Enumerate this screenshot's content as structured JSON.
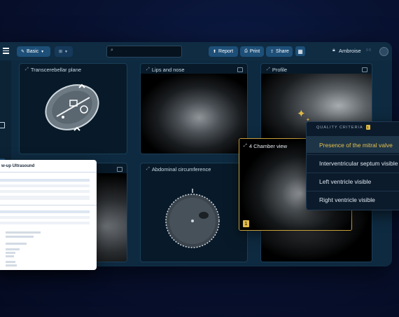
{
  "toolbar": {
    "view_label": "Basic",
    "report_label": "Report",
    "print_label": "Print",
    "share_label": "Share",
    "user_name": "Ambroise",
    "user_extra": "0  0"
  },
  "panels": {
    "transcerebellar": "Transcerebellar plane",
    "lips_nose": "Lips and nose",
    "profile": "Profile",
    "abdominal": "Abdominal circumference",
    "four_chamber": "4 Chamber view",
    "four_chamber_badge": "1"
  },
  "quality": {
    "header": "QUALITY CRITERIA",
    "badge": "1",
    "items": [
      "Presence of the mitral valve",
      "Interventricular septum visible",
      "Left ventricle visible",
      "Right ventricle visible"
    ]
  },
  "report_doc": {
    "title": "w-up Ultrasound"
  },
  "colors": {
    "background": "#070f2c",
    "window": "#0e2a40",
    "accent_gold": "#e3c04f",
    "pill_blue": "#1d4f78"
  }
}
